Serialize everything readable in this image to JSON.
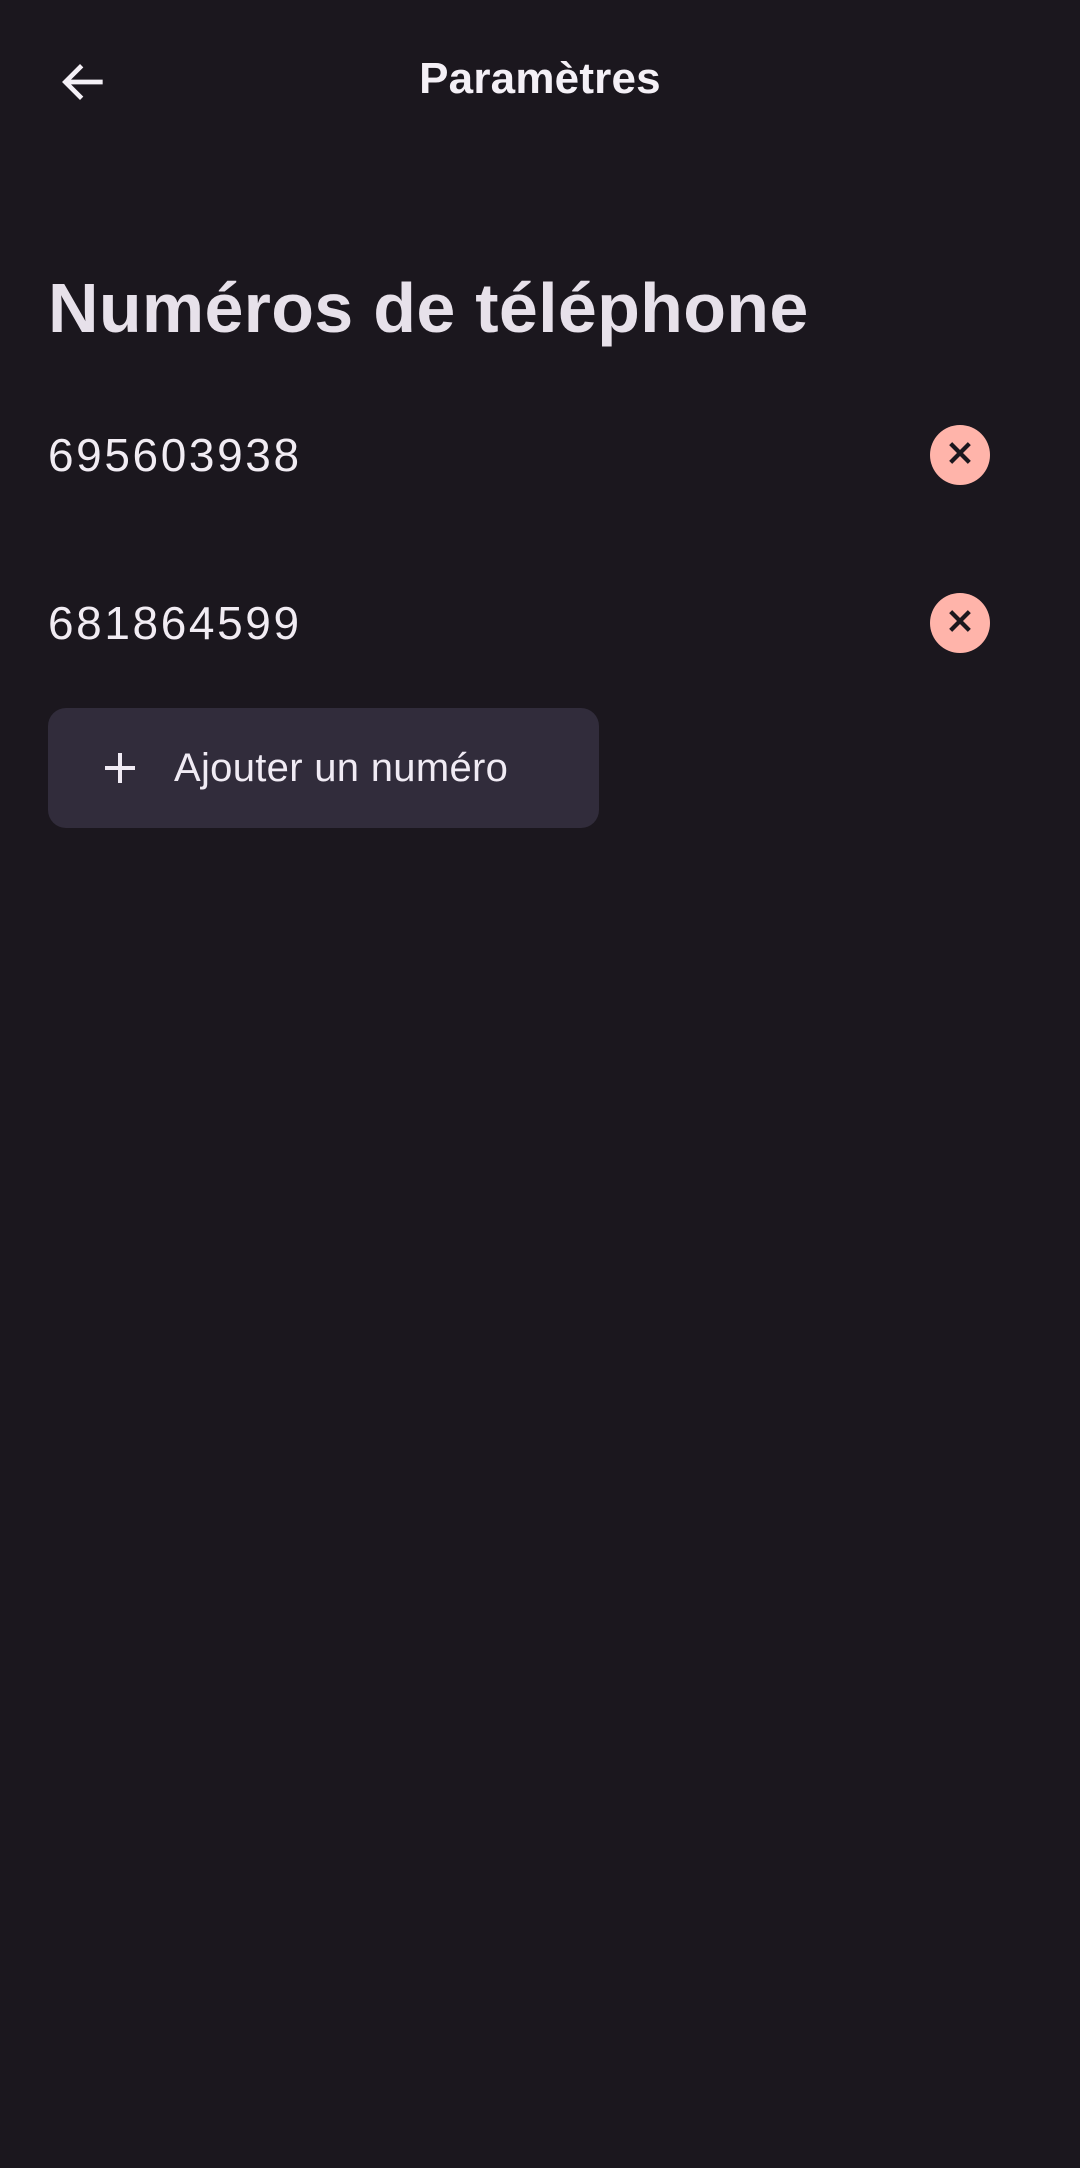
{
  "header": {
    "title": "Paramètres",
    "back_icon": "arrow-left-icon"
  },
  "section": {
    "title": "Numéros de téléphone"
  },
  "phones": [
    {
      "number": "695603938",
      "remove_icon": "close-icon"
    },
    {
      "number": "681864599",
      "remove_icon": "close-icon"
    }
  ],
  "add_button": {
    "icon": "plus-icon",
    "label": "Ajouter un numéro"
  },
  "colors": {
    "background": "#1b171e",
    "remove_button": "#ffb4aa",
    "add_button_bg": "#312c3b"
  }
}
